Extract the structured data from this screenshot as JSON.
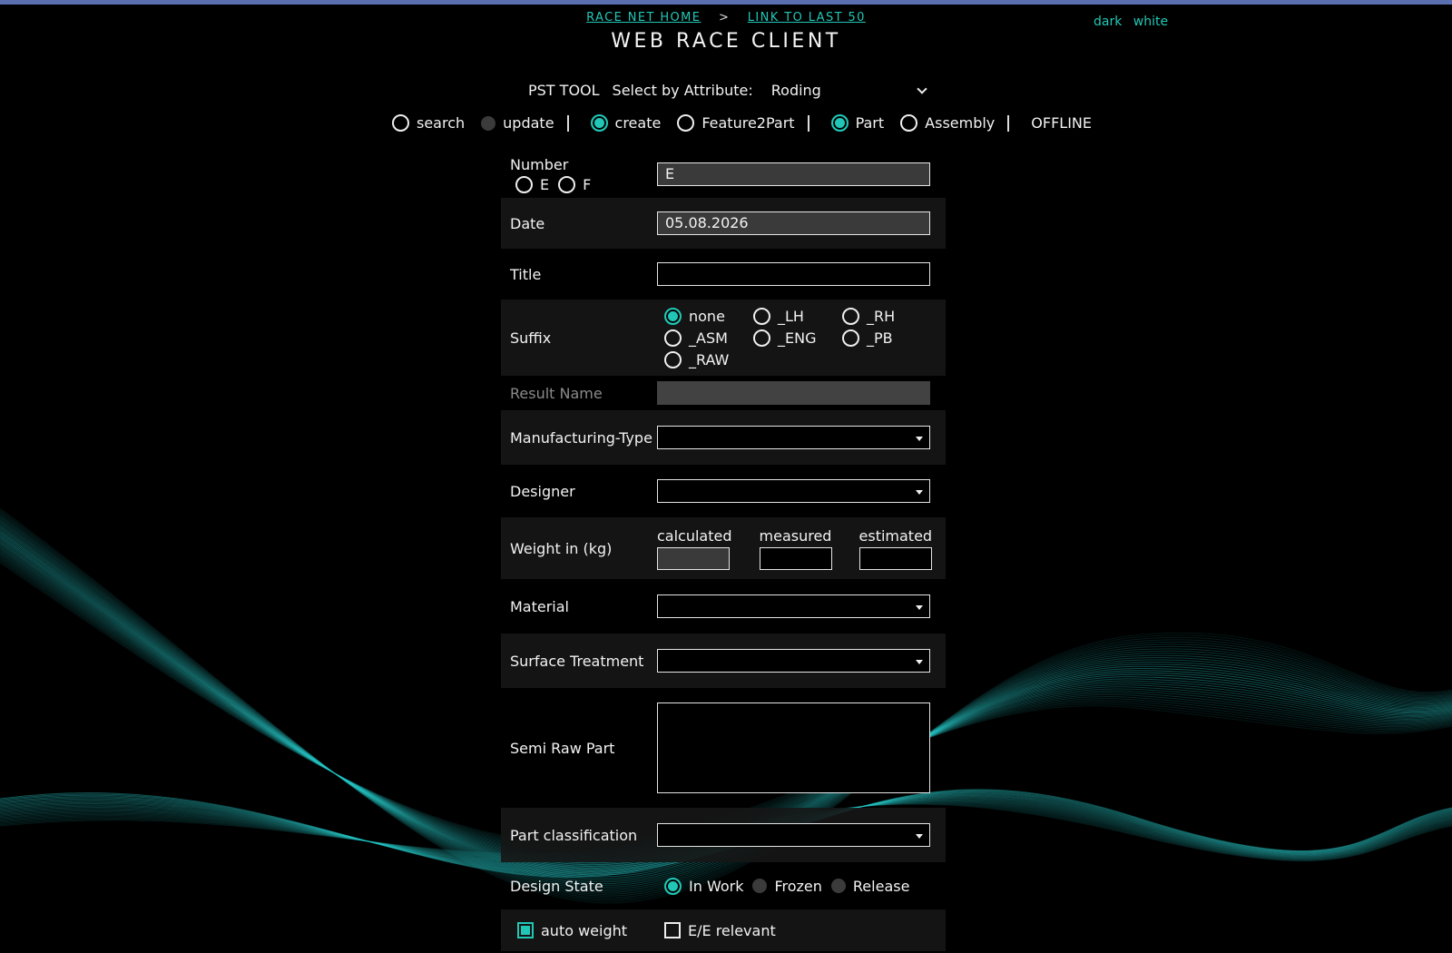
{
  "nav": {
    "home": "RACE NET HOME",
    "separator": ">",
    "last50": "LINK TO LAST 50"
  },
  "theme": {
    "dark": "dark",
    "white": "white"
  },
  "app_title": "WEB RACE CLIENT",
  "tool": {
    "name": "PST TOOL",
    "select_label": "Select by Attribute:",
    "select_value": "Roding"
  },
  "modes": {
    "search": "search",
    "update": "update",
    "create": "create",
    "feature2part": "Feature2Part",
    "part": "Part",
    "assembly": "Assembly",
    "status": "OFFLINE",
    "selected_action": "create",
    "selected_type": "Part"
  },
  "form": {
    "number": {
      "label": "Number",
      "value": "E",
      "opt_e": "E",
      "opt_f": "F"
    },
    "date": {
      "label": "Date",
      "value": "05.08.2026"
    },
    "title": {
      "label": "Title",
      "value": ""
    },
    "suffix": {
      "label": "Suffix",
      "options": [
        "none",
        "_LH",
        "_RH",
        "_ASM",
        "_ENG",
        "_PB",
        "_RAW"
      ],
      "selected": "none"
    },
    "result_name": {
      "label": "Result Name",
      "value": ""
    },
    "manufacturing_type": {
      "label": "Manufacturing-Type",
      "value": ""
    },
    "designer": {
      "label": "Designer",
      "value": ""
    },
    "weight": {
      "label": "Weight in (kg)",
      "calculated": "calculated",
      "measured": "measured",
      "estimated": "estimated"
    },
    "material": {
      "label": "Material",
      "value": ""
    },
    "surface_treatment": {
      "label": "Surface Treatment",
      "value": ""
    },
    "semi_raw_part": {
      "label": "Semi Raw Part",
      "value": ""
    },
    "part_classification": {
      "label": "Part classification",
      "value": ""
    },
    "design_state": {
      "label": "Design State",
      "in_work": "In Work",
      "frozen": "Frozen",
      "release": "Release",
      "selected": "In Work"
    },
    "auto_weight": {
      "label": "auto weight",
      "checked": true
    },
    "ee_relevant": {
      "label": "E/E relevant",
      "checked": false
    }
  },
  "colors": {
    "accent": "#21c7b6",
    "topbar": "#5a6fb0",
    "background": "#000000",
    "wave": "#28c8c8"
  }
}
